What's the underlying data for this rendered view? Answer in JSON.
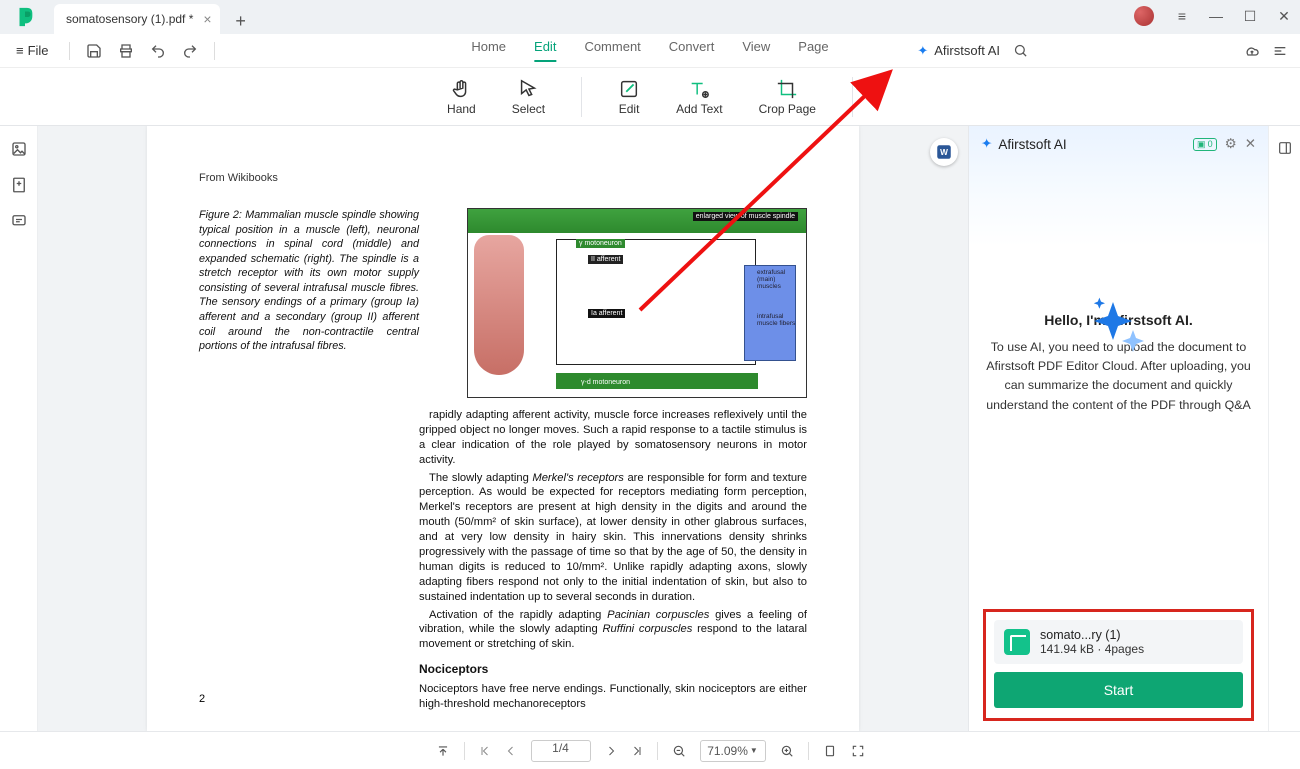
{
  "titlebar": {
    "tab_title": "somatosensory (1).pdf *"
  },
  "quickbar": {
    "file_label": "File",
    "tabs": {
      "home": "Home",
      "edit": "Edit",
      "comment": "Comment",
      "convert": "Convert",
      "view": "View",
      "page": "Page"
    },
    "ai_label": "Afirstsoft AI"
  },
  "ribbon": {
    "hand": "Hand",
    "select": "Select",
    "edit": "Edit",
    "add_text": "Add Text",
    "crop": "Crop Page"
  },
  "page": {
    "source": "From Wikibooks",
    "fig_caption": "Figure 2: Mammalian muscle spindle showing typical position in a muscle (left), neuronal connections in spinal cord (middle) and expanded schematic (right). The spindle is a stretch receptor with its own motor supply consisting of several intrafusal muscle fibres. The sensory endings of a primary (group Ia) afferent and a secondary (group II) afferent coil around the non-contractile central portions of the intrafusal fibres.",
    "fig_labels": {
      "top": "enlarged view of muscle spindle",
      "a": "γ motoneuron",
      "b": "II afferent",
      "c": "Ia afferent",
      "d": "γ-d motoneuron",
      "e": "extrafusal (main) muscles",
      "f": "intrafusal muscle fibers"
    },
    "p1": "rapidly adapting afferent activity, muscle force increases reflexively until the gripped object no longer moves. Such a rapid response to a tactile stimulus is a clear indication of the role played by somatosensory neurons in motor activity.",
    "p2_a": "The slowly adapting ",
    "p2_i": "Merkel's receptors",
    "p2_b": " are responsible for form and texture perception. As would be expected for receptors mediating form perception, Merkel's receptors are present at high density in the digits and around the mouth (50/mm² of skin surface), at lower density in other glabrous surfaces, and at very low density in hairy skin. This innervations density shrinks progressively with the passage of time so that by the age of 50, the density in human digits is reduced to 10/mm². Unlike rapidly adapting axons, slowly adapting fibers respond not only to the initial indentation of skin, but also to sustained indentation up to several seconds in duration.",
    "p3_a": "Activation of the rapidly adapting ",
    "p3_i1": "Pacinian corpuscles",
    "p3_b": " gives a feeling of vibration, while the slowly adapting ",
    "p3_i2": "Ruffini corpuscles",
    "p3_c": " respond to the lataral movement or stretching of skin.",
    "h4": "Nociceptors",
    "p4": "Nociceptors have free nerve endings. Functionally, skin nociceptors are either high-threshold mechanoreceptors",
    "page_number": "2"
  },
  "ai": {
    "title": "Afirstsoft AI",
    "badge_count": "0",
    "hello": "Hello, I'm Afirstsoft AI.",
    "instructions": "To use AI, you need to upload the document to Afirstsoft PDF Editor Cloud. After uploading, you can summarize the document and quickly understand the content of the PDF through Q&A",
    "file_name": "somato...ry (1)",
    "file_meta": "141.94 kB · 4pages",
    "start_label": "Start"
  },
  "status": {
    "page_indicator": "1/4",
    "zoom": "71.09%"
  }
}
